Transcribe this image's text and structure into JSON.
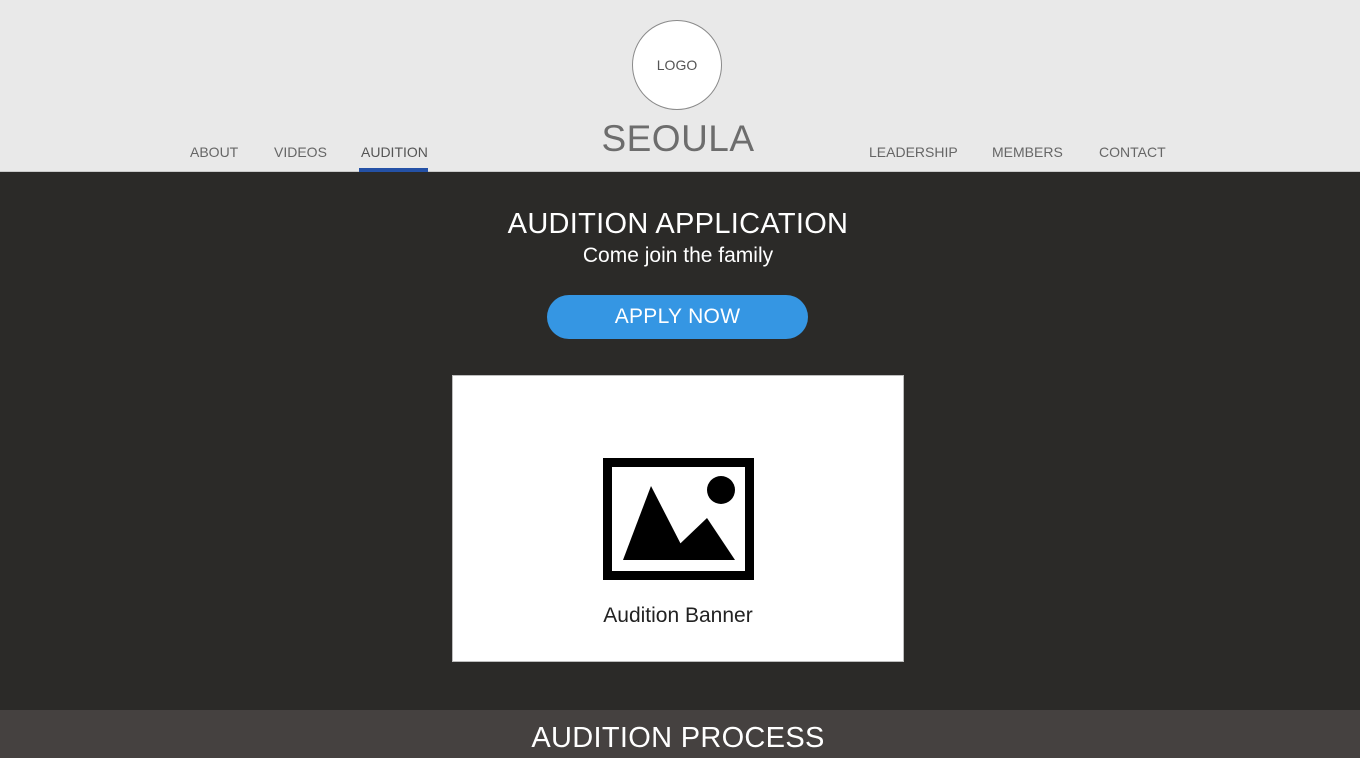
{
  "header": {
    "logo_text": "LOGO",
    "brand": "SEOULA",
    "nav_left": [
      {
        "label": "ABOUT"
      },
      {
        "label": "VIDEOS"
      },
      {
        "label": "AUDITION"
      }
    ],
    "nav_right": [
      {
        "label": "LEADERSHIP"
      },
      {
        "label": "MEMBERS"
      },
      {
        "label": "CONTACT"
      }
    ],
    "active_nav": "AUDITION"
  },
  "hero": {
    "title": "AUDITION APPLICATION",
    "subtitle": "Come join the family",
    "cta_label": "APPLY NOW",
    "banner_label": "Audition Banner",
    "banner_icon": "image-placeholder-icon"
  },
  "process": {
    "title": "AUDITION PROCESS"
  },
  "colors": {
    "header_bg": "#e9e9e9",
    "hero_bg": "#2b2a28",
    "cta_bg": "#3596e3",
    "active_underline": "#2451a6",
    "process_bg": "#454140"
  }
}
